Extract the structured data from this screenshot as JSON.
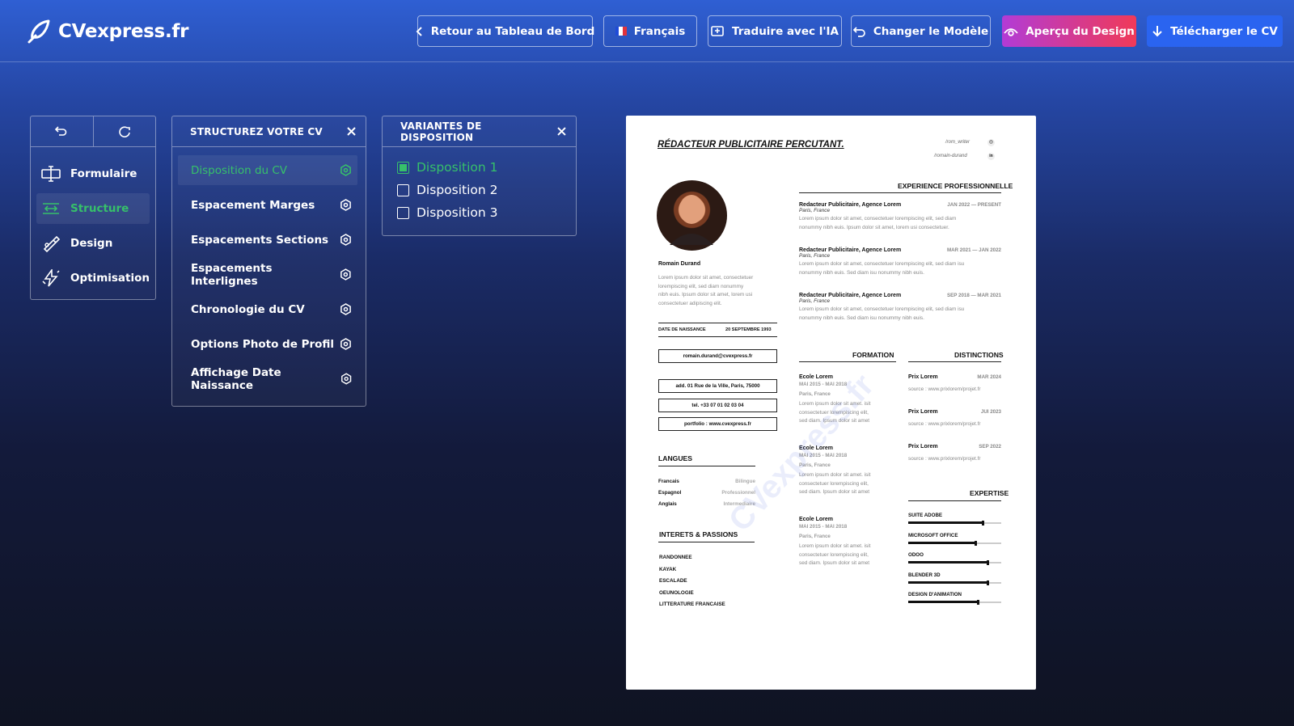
{
  "brand": {
    "name": "CVexpress.fr"
  },
  "topbar": {
    "back": "Retour au Tableau de Bord",
    "language": "Français",
    "translate": "Traduire avec l'IA",
    "template": "Changer le Modèle",
    "preview": "Aperçu du Design",
    "download": "Télécharger le CV"
  },
  "sidebar": {
    "items": [
      {
        "label": "Formulaire",
        "icon": "form-icon"
      },
      {
        "label": "Structure",
        "icon": "structure-icon",
        "active": true
      },
      {
        "label": "Design",
        "icon": "brush-icon"
      },
      {
        "label": "Optimisation",
        "icon": "bolt-icon"
      }
    ]
  },
  "structure_panel": {
    "title": "STRUCTUREZ VOTRE CV",
    "items": [
      "Disposition du CV",
      "Espacement Marges",
      "Espacements Sections",
      "Espacements Interlignes",
      "Chronologie du CV",
      "Options Photo de Profil",
      "Affichage Date Naissance"
    ]
  },
  "layout_panel": {
    "title": "VARIANTES DE DISPOSITION",
    "options": [
      "Disposition 1",
      "Disposition 2",
      "Disposition 3"
    ],
    "selected": "Disposition 1"
  },
  "cv": {
    "title": "RÉDACTEUR PUBLICITAIRE PERCUTANT.",
    "socials": [
      "/rom_writer",
      "/romain-durand"
    ],
    "name": "Romain Durand",
    "intro": [
      "Lorem ipsum dolor sit amet, consectetuer",
      "lorempiscing elit, sed diam nonummy",
      "nibh euis. Ipsum dolor sit amet, lorem usi",
      "consectetuer adipiscing elit."
    ],
    "birth_label": "DATE DE NAISSANCE",
    "birth_value": "20 SEPTEMBRE 1993",
    "email": "romain.durand@cvexpress.fr",
    "address": "add.  01 Rue de la Ville, Paris, 75000",
    "phone": "tel. +33 07 01 02 03 04",
    "portfolio": "portfolio : www.cvexpress.fr",
    "languages_title": "LANGUES",
    "languages": [
      {
        "name": "Francais",
        "level": "Bilingue"
      },
      {
        "name": "Espagnol",
        "level": "Professionnel"
      },
      {
        "name": "Anglais",
        "level": "Intermediaire"
      }
    ],
    "interests_title": "INTERETS & PASSIONS",
    "interests": [
      "RANDONNEE",
      "KAYAK",
      "ESCALADE",
      "OEUNOLOGIE",
      "LITTERATURE FRANCAISE"
    ],
    "experience_title": "EXPERIENCE PROFESSIONNELLE",
    "experience": [
      {
        "role": "Redacteur Publicitaire, Agence Lorem",
        "place": "Paris, France",
        "dates": "JAN 2022 — PRESENT",
        "d1": "Lorem ipsum dolor sit amet, consectetuer lorempiscing elit, sed diam",
        "d2": "nonummy nibh euis. Ipsum dolor sit amet, lorem usi consectetuer."
      },
      {
        "role": "Redacteur Publicitaire, Agence Lorem",
        "place": "Paris, France",
        "dates": "MAR 2021 — JAN 2022",
        "d1": "Lorem ipsum dolor sit amet, consectetuer lorempiscing elit, sed diam isu",
        "d2": "nonummy nibh euis. Sed diam isu nonummy nibh euis."
      },
      {
        "role": "Redacteur Publicitaire, Agence Lorem",
        "place": "Paris, France",
        "dates": "SEP 2018 — MAR 2021",
        "d1": "Lorem ipsum dolor sit amet, consectetuer lorempiscing elit, sed diam isu",
        "d2": "nonummy nibh euis. Sed diam isu nonummy nibh euis."
      }
    ],
    "formation_title": "FORMATION",
    "formation": [
      {
        "school": "Ecole Lorem",
        "dates": "MAI 2015 - MAI 2018",
        "city": "Paris, France",
        "d1": "Lorem ipsum dolor sit amet. isit",
        "d2": "consectetuer lorempiscing elit,",
        "d3": "sed diam. Ipsum dolor sit amet"
      },
      {
        "school": "Ecole Lorem",
        "dates": "MAI 2015 - MAI 2018",
        "city": "Paris, France",
        "d1": "Lorem ipsum dolor sit amet. isit",
        "d2": "consectetuer lorempiscing elit,",
        "d3": "sed diam. Ipsum dolor sit amet"
      },
      {
        "school": "Ecole Lorem",
        "dates": "MAI 2015 - MAI 2018",
        "city": "Paris, France",
        "d1": "Lorem ipsum dolor sit amet. isit",
        "d2": "consectetuer lorempiscing elit,",
        "d3": "sed diam. Ipsum dolor sit amet"
      }
    ],
    "distinctions_title": "DISTINCTIONS",
    "distinctions": [
      {
        "name": "Prix Lorem",
        "date": "MAR 2024",
        "source": "source : www.prixlorem/projet.fr"
      },
      {
        "name": "Prix Lorem",
        "date": "JUI 2023",
        "source": "source : www.prixlorem/projet.fr"
      },
      {
        "name": "Prix Lorem",
        "date": "SEP 2022",
        "source": "source : www.prixlorem/projet.fr"
      }
    ],
    "expertise_title": "EXPERTISE",
    "expertise": [
      {
        "name": "SUITE ADOBE",
        "level": 0.8
      },
      {
        "name": "MICROSOFT OFFICE",
        "level": 0.72
      },
      {
        "name": "ODOO",
        "level": 0.85
      },
      {
        "name": "BLENDER 3D",
        "level": 0.85
      },
      {
        "name": "DESIGN D'ANIMATION",
        "level": 0.75
      }
    ],
    "watermark": "CVexpress.fr"
  },
  "colors": {
    "accent": "#36c06a",
    "download": "#2a64f0",
    "preview_start": "#b23bd6",
    "preview_end": "#f03a58"
  }
}
